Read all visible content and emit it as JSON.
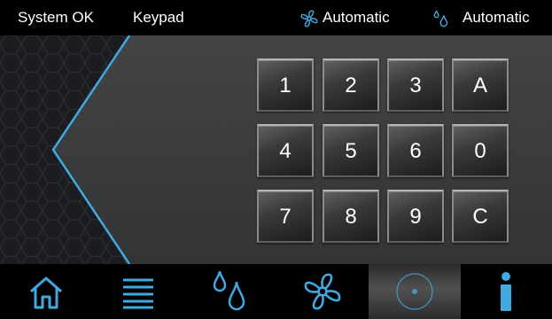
{
  "status_bar": {
    "system_status": "System OK",
    "page_name": "Keypad",
    "fan_mode": "Automatic",
    "humidity_mode": "Automatic",
    "fan_icon": "fan-icon",
    "humidity_icon": "water-drops-icon"
  },
  "keypad": {
    "keys": [
      "1",
      "2",
      "3",
      "A",
      "4",
      "5",
      "6",
      "0",
      "7",
      "8",
      "9",
      "C"
    ]
  },
  "nav": {
    "items": [
      {
        "name": "home",
        "icon": "home-icon",
        "active": false
      },
      {
        "name": "menu",
        "icon": "menu-icon",
        "active": false
      },
      {
        "name": "humidity",
        "icon": "water-drops-icon",
        "active": false
      },
      {
        "name": "fan",
        "icon": "fan-icon",
        "active": false
      },
      {
        "name": "dial",
        "icon": "dial-icon",
        "active": true
      },
      {
        "name": "info",
        "icon": "info-icon",
        "active": false
      }
    ]
  },
  "colors": {
    "accent": "#3fa9e0",
    "status_bar_bg": "#000000",
    "main_bg": "#3b3b3d"
  }
}
